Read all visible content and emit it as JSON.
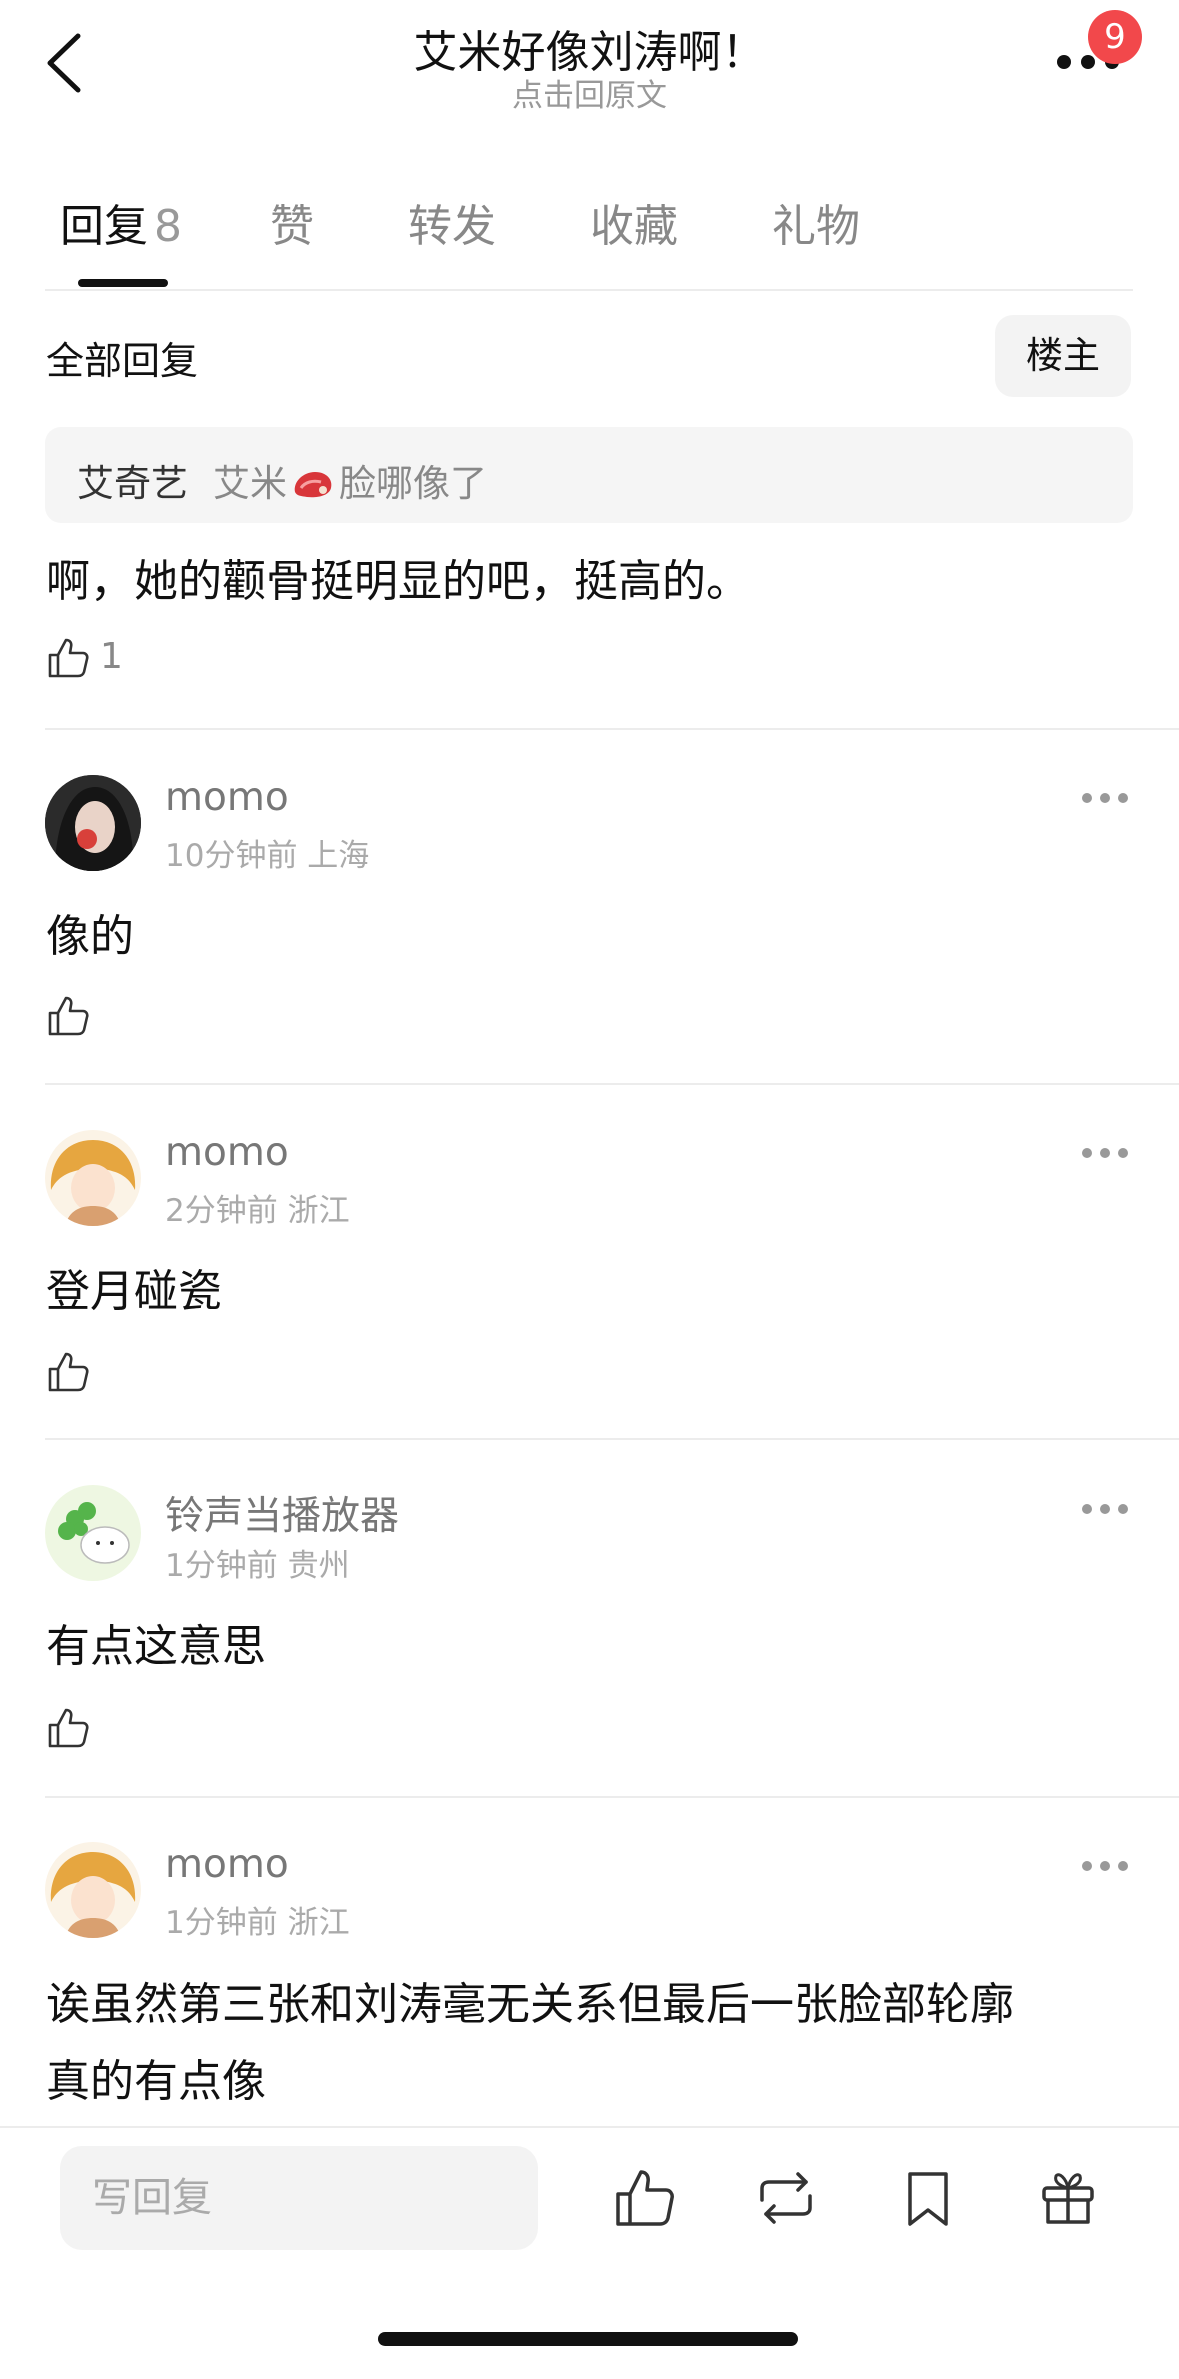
{
  "header": {
    "title": "艾米好像刘涛啊！",
    "subtitle": "点击回原文",
    "badge_count": "9"
  },
  "tabs": [
    {
      "label": "回复",
      "count": "8",
      "active": true
    },
    {
      "label": "赞"
    },
    {
      "label": "转发"
    },
    {
      "label": "收藏"
    },
    {
      "label": "礼物"
    }
  ],
  "section": {
    "title": "全部回复",
    "owner_button": "楼主"
  },
  "quoted_reply": {
    "author": "艾奇艺",
    "text_before": "艾米",
    "text_after": "脸哪像了",
    "emoji": "meat-emoji"
  },
  "first_reply": {
    "text": "啊，她的颧骨挺明显的吧，挺高的。",
    "likes": "1"
  },
  "comments": [
    {
      "name": "momo",
      "meta": "10分钟前 上海",
      "text": "像的"
    },
    {
      "name": "momo",
      "meta": "2分钟前 浙江",
      "text": "登月碰瓷"
    },
    {
      "name": "铃声当播放器",
      "meta": "1分钟前 贵州",
      "text": "有点这意思"
    },
    {
      "name": "momo",
      "meta": "1分钟前 浙江",
      "text_line1": "诶虽然第三张和刘涛毫无关系但最后一张脸部轮廓",
      "text_line2": "真的有点像"
    }
  ],
  "bottom_bar": {
    "reply_placeholder": "写回复",
    "icons": [
      "thumbs-up-icon",
      "repost-icon",
      "bookmark-icon",
      "gift-icon"
    ]
  }
}
